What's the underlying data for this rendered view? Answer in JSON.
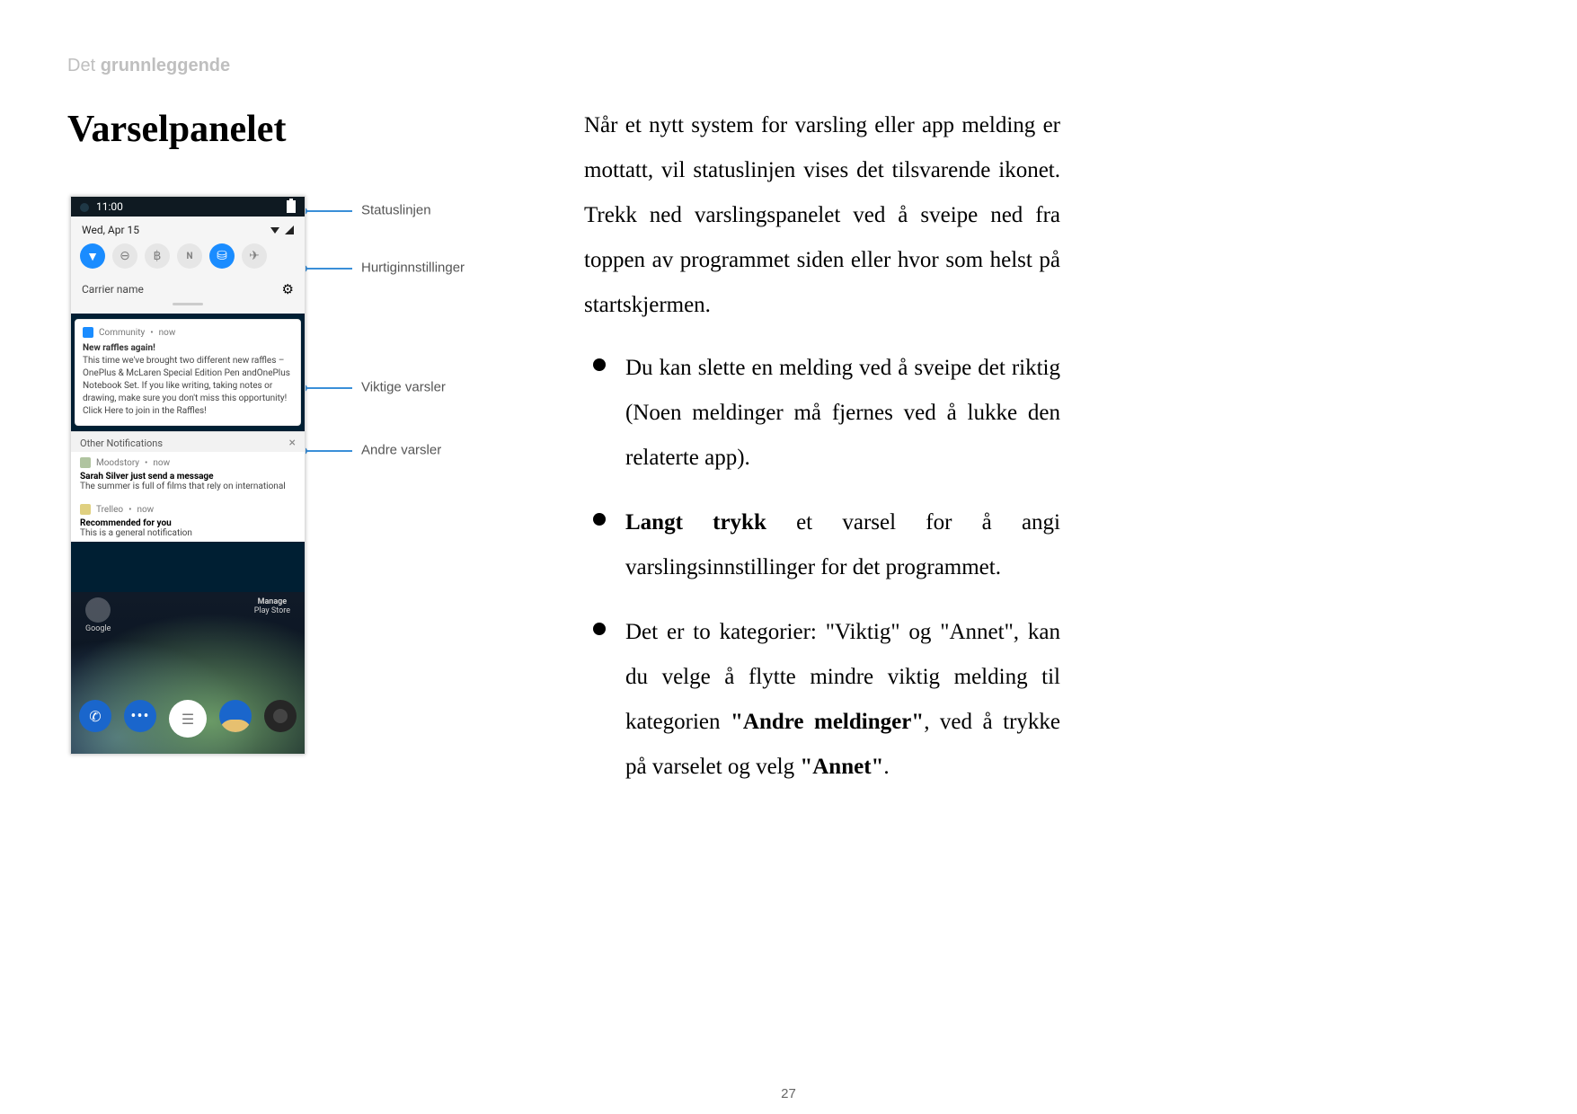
{
  "breadcrumb": {
    "prefix": "Det ",
    "bold": "grunnleggende"
  },
  "title": "Varselpanelet",
  "intro": "Når et nytt system for varsling eller app melding er mottatt, vil statuslinjen vises det tilsvarende ikonet. Trekk ned varslingspanelet ved å sveipe ned fra toppen av programmet siden eller hvor som helst på startskjermen.",
  "bullets": [
    "Du kan slette en melding ved å sveipe det riktig (Noen meldinger må fjernes ved å lukke den relaterte app).",
    "<b>Langt trykk</b> et varsel for å angi varslingsinnstillinger for det programmet.",
    "Det er to kategorier: \"Viktig\" og \"Annet\", kan du velge å flytte mindre viktig melding til kategorien <b>\"Andre meldinger\"</b>, ved å trykke på varselet og velg <b>\"Annet\"</b>."
  ],
  "page_number": "27",
  "callouts": {
    "status_bar": "Statuslinjen",
    "quick_settings": "Hurtiginnstillinger",
    "important": "Viktige varsler",
    "other": "Andre varsler"
  },
  "screenshot": {
    "status_time": "11:00",
    "date": "Wed, Apr 15",
    "carrier": "Carrier name",
    "notif1": {
      "app": "Community",
      "time": "now",
      "title": "New raffles again!",
      "body": "This time we've brought two different new raffles – OnePlus & McLaren Special Edition Pen andOnePlus Notebook Set. If you like writing, taking notes or drawing, make sure you don't miss this opportunity! Click Here to join in the Raffles!"
    },
    "other_header": "Other Notifications",
    "notif2": {
      "app": "Moodstory",
      "time": "now",
      "title": "Sarah Silver just send a message",
      "body": "The summer is full of films that rely on international"
    },
    "notif3": {
      "app": "Trelleo",
      "time": "now",
      "title": "Recommended for you",
      "body": "This is a general notification"
    },
    "hs_left": "Google",
    "hs_right_top": "Manage",
    "hs_right_bottom": "Play Store"
  }
}
